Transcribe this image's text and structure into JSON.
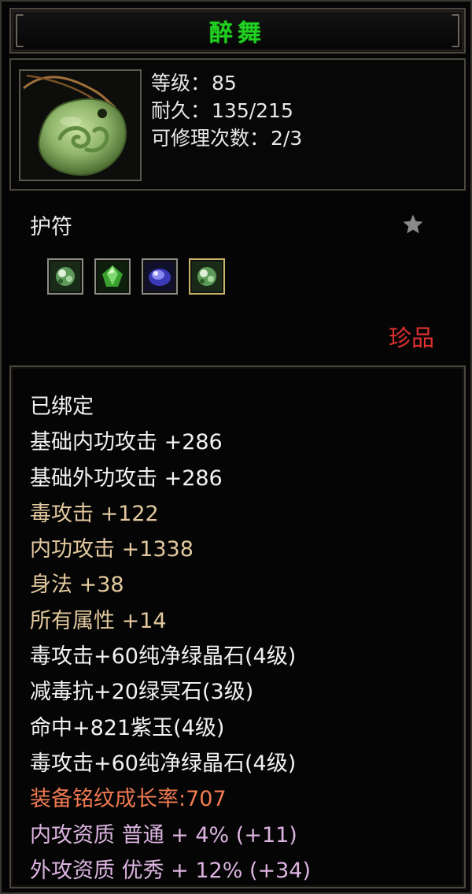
{
  "item": {
    "name": "醉舞",
    "stats": [
      {
        "label": "等级：",
        "value": "85"
      },
      {
        "label": "耐久：",
        "value": "135/215"
      },
      {
        "label": "可修理次数：",
        "value": "2/3"
      }
    ],
    "category": "护符",
    "rarity": "珍品",
    "icon": "jade-amulet-icon",
    "sockets": [
      {
        "icon": "green-gem-socket-icon"
      },
      {
        "icon": "emerald-gem-socket-icon"
      },
      {
        "icon": "purple-gem-socket-icon"
      },
      {
        "icon": "green-gem-socket-icon"
      }
    ]
  },
  "attributes": [
    {
      "text": "已绑定",
      "color": "#f2f2f2"
    },
    {
      "text": "基础内功攻击  +286",
      "color": "#f2f2f2"
    },
    {
      "text": "基础外功攻击  +286",
      "color": "#f2f2f2"
    },
    {
      "text": "毒攻击  +122",
      "color": "#e2c89e"
    },
    {
      "text": "内功攻击  +1338",
      "color": "#e2c89e"
    },
    {
      "text": "身法  +38",
      "color": "#e2c89e"
    },
    {
      "text": "所有属性  +14",
      "color": "#e2c89e"
    },
    {
      "text": "毒攻击+60纯净绿晶石(4级)",
      "color": "#f2f2f2"
    },
    {
      "text": "减毒抗+20绿冥石(3级)",
      "color": "#f2f2f2"
    },
    {
      "text": "命中+821紫玉(4级)",
      "color": "#f2f2f2"
    },
    {
      "text": "毒攻击+60纯净绿晶石(4级)",
      "color": "#f2f2f2"
    },
    {
      "text": "装备铭纹成长率:707",
      "color": "#f07a52"
    },
    {
      "text": "内攻资质  普通  + 4% (+11)",
      "color": "#dcb4e0"
    },
    {
      "text": "外攻资质  优秀  + 12% (+34)",
      "color": "#dcb4e0"
    }
  ],
  "colors": {
    "title": "#22d022",
    "rarity": "#e03030",
    "frame_border": "#4a463e"
  }
}
